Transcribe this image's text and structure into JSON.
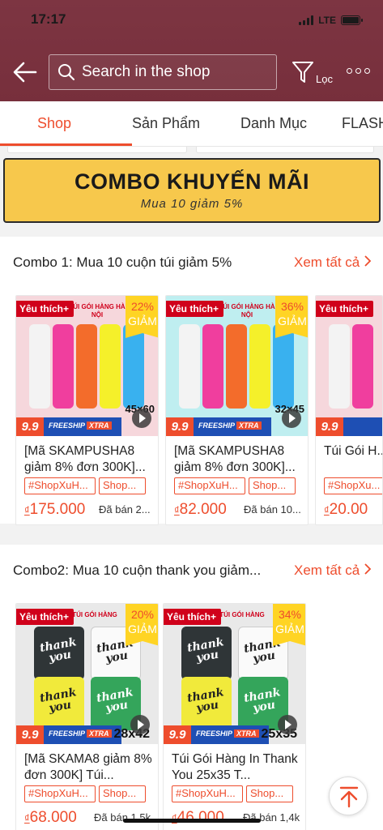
{
  "status": {
    "time": "17:17",
    "network": "LTE"
  },
  "search": {
    "placeholder": "Search in the shop"
  },
  "header": {
    "filter_label": "Lọc"
  },
  "tabs": [
    {
      "label": "Shop",
      "active": true
    },
    {
      "label": "Sản Phẩm"
    },
    {
      "label": "Danh Mục"
    },
    {
      "label": "FLASH"
    }
  ],
  "banner": {
    "title": "COMBO KHUYẾN MÃI",
    "subtitle": "Mua 10 giảm 5%"
  },
  "sections": [
    {
      "title": "Combo 1: Mua 10 cuộn túi giảm 5%",
      "see_all": "Xem tất cả",
      "products": [
        {
          "favorite": "Yêu thích+",
          "brand": "TÚI GÓI HÀNG HÀ NỘI",
          "discount": "22%",
          "discount_word": "GIẢM",
          "size": "45×60",
          "name": "[Mã SKAMPUSHA8 giảm 8% đơn 300K]...",
          "tags": [
            "#ShopXuH...",
            "Shop..."
          ],
          "currency": "₫",
          "price": "175.000",
          "sold": "Đã bán 2..."
        },
        {
          "favorite": "Yêu thích+",
          "brand": "TÚI GÓI HÀNG HÀ NỘI",
          "discount": "36%",
          "discount_word": "GIẢM",
          "size": "32×45",
          "name": "[Mã SKAMPUSHA8 giảm 8% đơn 300K]...",
          "tags": [
            "#ShopXuH...",
            "Shop..."
          ],
          "currency": "₫",
          "price": "82.000",
          "sold": "Đã bán 10..."
        },
        {
          "favorite": "Yêu thích+",
          "name": "Túi Gói H... Niêm Pho...",
          "tags": [
            "#ShopXu..."
          ],
          "currency": "₫",
          "price": "20.00"
        }
      ]
    },
    {
      "title": "Combo2: Mua 10 cuộn thank you giảm...",
      "see_all": "Xem tất cả",
      "products": [
        {
          "favorite": "Yêu thích+",
          "brand": "TÚI GÓI HÀNG",
          "discount": "20%",
          "discount_word": "GIẢM",
          "size": "28x42",
          "name": "[Mã SKAMA8 giảm 8% đơn 300K] Túi...",
          "tags": [
            "#ShopXuH...",
            "Shop..."
          ],
          "currency": "₫",
          "price": "68.000",
          "sold": "Đã bán 1,5k"
        },
        {
          "favorite": "Yêu thích+",
          "brand": "TÚI GÓI HÀNG",
          "discount": "34%",
          "discount_word": "GIẢM",
          "size": "25x35",
          "name": "Túi Gói Hàng In Thank You 25x35 T...",
          "tags": [
            "#ShopXuH...",
            "Shop..."
          ],
          "currency": "₫",
          "price": "46.000",
          "sold": "Đã bán 1,4k"
        }
      ]
    }
  ],
  "promo_badge": {
    "number": "9.9",
    "freeship": "FREESHIP",
    "xtra": "XTRA"
  },
  "bag_text": "thank you",
  "colors": {
    "header": "#7a3340",
    "accent": "#ee4d2d",
    "banner": "#f7c84c"
  }
}
